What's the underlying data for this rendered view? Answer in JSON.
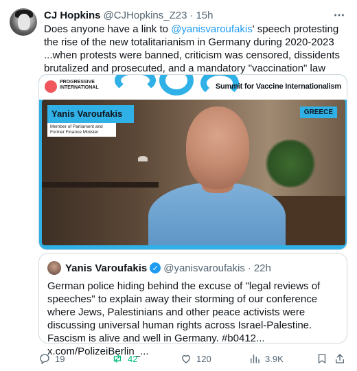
{
  "author": {
    "name": "CJ Hopkins",
    "handle": "@CJHopkins_Z23",
    "separator": "·",
    "time": "15h"
  },
  "tweet": {
    "text_before": "Does anyone have a link to ",
    "mention": "@yanisvaroufakis",
    "text_after": "' speech protesting the rise of the new totalitarianism in Germany during 2020-2023 ...when protests were banned, criticism was censored, dissidents brutalized and prosecuted, and a mandatory \"vaccination\" law was almost passed?"
  },
  "media": {
    "org_line": "PROGRESSIVE INTERNATIONAL",
    "event_title": "Summit for Vaccine Internationalism",
    "speaker_name": "Yanis Varoufakis",
    "speaker_title": "Member of Parliament and Former Finance Minister",
    "country": "GREECE"
  },
  "quote": {
    "name": "Yanis Varoufakis",
    "handle": "@yanisvaroufakis",
    "separator": "·",
    "time": "22h",
    "text": "German police hiding behind the excuse of \"legal reviews of speeches\" to explain away their storming of our conference where Jews, Palestinians and other peace activists were discussing universal human rights across Israel-Palestine. Fascism is alive and well in Germany. #b0412... x.com/PolizeiBerlin_..."
  },
  "actions": {
    "replies": "19",
    "retweets": "42",
    "likes": "120",
    "views": "3.9K"
  },
  "icons": {
    "more": "more-icon",
    "reply": "reply-icon",
    "retweet": "retweet-icon",
    "like": "heart-icon",
    "views": "views-icon",
    "bookmark": "bookmark-icon",
    "share": "share-icon",
    "verified": "verified-icon"
  },
  "colors": {
    "accent": "#1d9bf0",
    "retweet_active": "#00ba7c",
    "muted": "#536471",
    "brand_blue": "#2fb0e6"
  }
}
